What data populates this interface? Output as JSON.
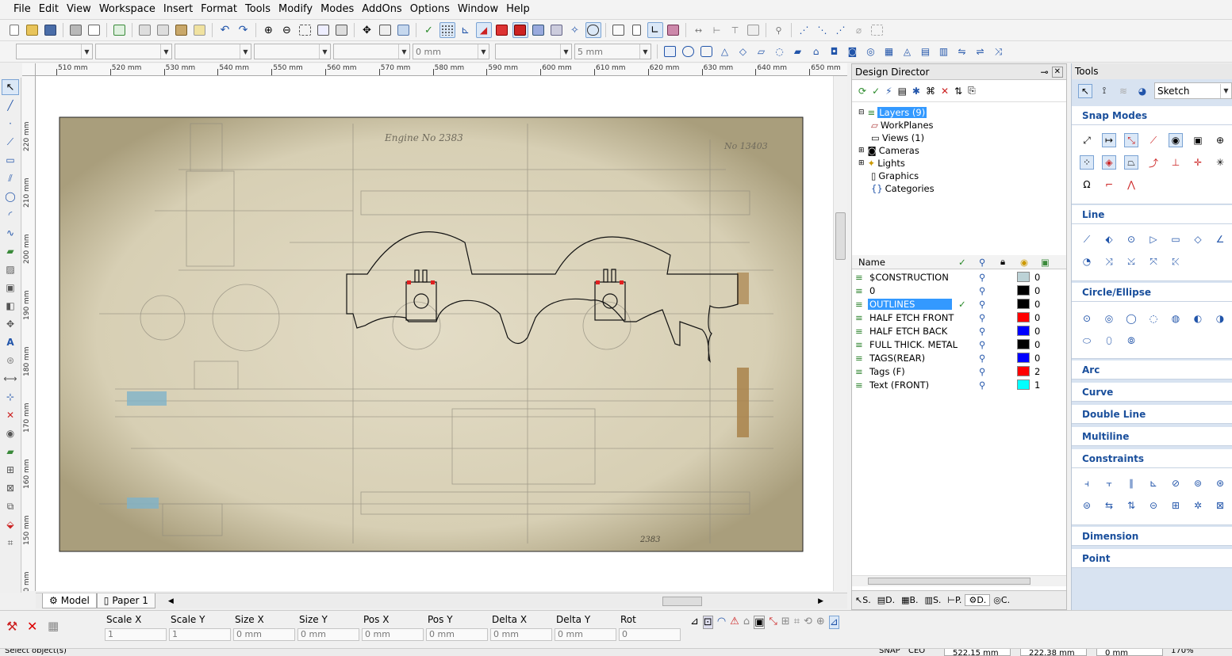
{
  "menu": [
    "File",
    "Edit",
    "View",
    "Workspace",
    "Insert",
    "Format",
    "Tools",
    "Modify",
    "Modes",
    "AddOns",
    "Options",
    "Window",
    "Help"
  ],
  "toolbar2": {
    "thickness_combo": "0 mm",
    "size_combo": "5 mm"
  },
  "hruler": {
    "labels": [
      "510 mm",
      "520 mm",
      "530 mm",
      "540 mm",
      "550 mm",
      "560 mm",
      "570 mm",
      "580 mm",
      "590 mm",
      "600 mm",
      "610 mm",
      "620 mm",
      "630 mm",
      "640 mm",
      "650 mm"
    ]
  },
  "vruler": {
    "labels": [
      "220 mm",
      "210 mm",
      "200 mm",
      "190 mm",
      "180 mm",
      "170 mm",
      "160 mm",
      "150 mm",
      "140 mm"
    ]
  },
  "drawing": {
    "sheet_title": "Engine No 2383",
    "sheet_number": "No 13403",
    "sheet_footer": "2383",
    "colors": {
      "paper": "#dcd4bc",
      "stain": "#b8ad8c",
      "ink": "#8f8a7c",
      "outline": "#111111",
      "tag_red": "#e02020",
      "wood": "#a9824a",
      "blue": "#7fb3c9"
    }
  },
  "tabs": {
    "model": "Model",
    "paper": "Paper 1"
  },
  "design_director": {
    "title": "Design Director",
    "tree": [
      "Layers (9)",
      "WorkPlanes",
      "Views (1)",
      "Cameras",
      "Lights",
      "Graphics",
      "Categories"
    ],
    "columns": {
      "name": "Name"
    },
    "layers": [
      {
        "name": "$CONSTRUCTION",
        "color": "#bcd2d6",
        "value": "0",
        "current": false,
        "selected": false
      },
      {
        "name": "0",
        "color": "#000000",
        "value": "0",
        "current": false,
        "selected": false
      },
      {
        "name": "OUTLINES",
        "color": "#000000",
        "value": "0",
        "current": true,
        "selected": true
      },
      {
        "name": "HALF ETCH FRONT",
        "color": "#ff0000",
        "value": "0",
        "current": false,
        "selected": false
      },
      {
        "name": "HALF ETCH BACK",
        "color": "#0000ff",
        "value": "0",
        "current": false,
        "selected": false
      },
      {
        "name": "FULL THICK. METAL",
        "color": "#000000",
        "value": "0",
        "current": false,
        "selected": false
      },
      {
        "name": "TAGS(REAR)",
        "color": "#0000ff",
        "value": "0",
        "current": false,
        "selected": false
      },
      {
        "name": "Tags (F)",
        "color": "#ff0000",
        "value": "2",
        "current": false,
        "selected": false
      },
      {
        "name": "Text (FRONT)",
        "color": "#00ffff",
        "value": "1",
        "current": false,
        "selected": false
      }
    ],
    "bottom_tabs": [
      "S.",
      "D.",
      "B.",
      "S.",
      "P.",
      "D.",
      "C."
    ]
  },
  "tools": {
    "title": "Tools",
    "mode_combo": "Sketch",
    "sections": [
      "Snap Modes",
      "Line",
      "Circle/Ellipse",
      "Arc",
      "Curve",
      "Double Line",
      "Multiline",
      "Constraints",
      "Dimension",
      "Point"
    ]
  },
  "props": {
    "labels": [
      "Scale X",
      "Scale Y",
      "Size X",
      "Size Y",
      "Pos X",
      "Pos Y",
      "Delta X",
      "Delta Y",
      "Rot"
    ],
    "values": [
      "1",
      "1",
      "0 mm",
      "0 mm",
      "0 mm",
      "0 mm",
      "0 mm",
      "0 mm",
      "0"
    ]
  },
  "status": {
    "prompt": "Select object(s)",
    "snap": "SNAP",
    "ceo": "CEO",
    "x": "522.15 mm",
    "y": "222.38 mm",
    "z": "0 mm",
    "zoom": "170%"
  }
}
